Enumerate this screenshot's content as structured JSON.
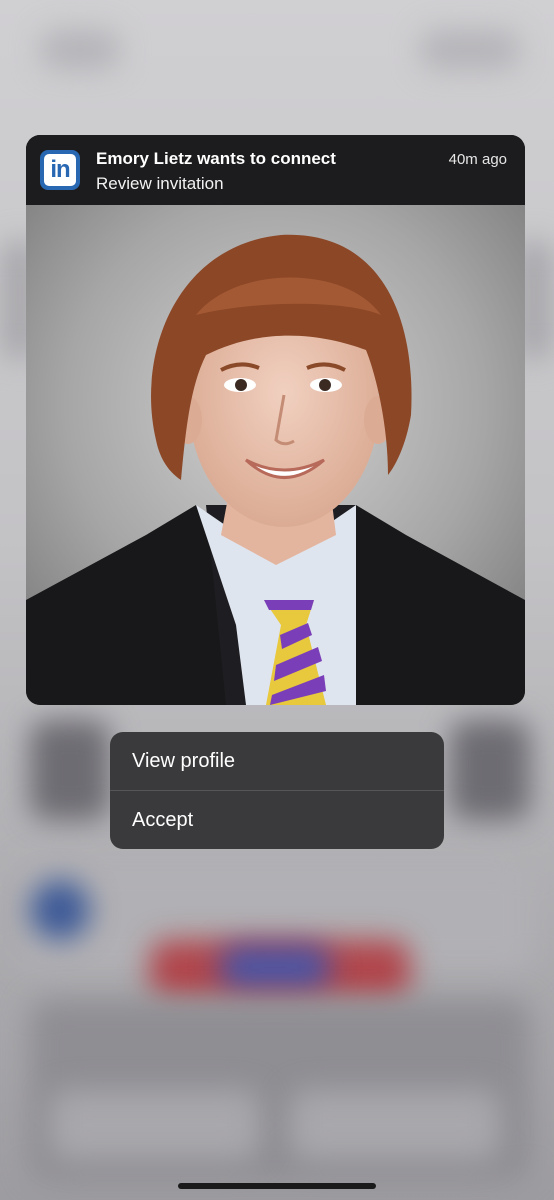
{
  "notification": {
    "app_icon": "linkedin-icon",
    "app_icon_text": "in",
    "title": "Emory Lietz wants to connect",
    "subtitle": "Review invitation",
    "time": "40m ago"
  },
  "menu": {
    "items": [
      {
        "label": "View profile"
      },
      {
        "label": "Accept"
      }
    ]
  },
  "colors": {
    "linkedin_blue": "#2867b2",
    "card_bg": "#1c1c1e",
    "menu_bg": "#3a3a3c"
  }
}
